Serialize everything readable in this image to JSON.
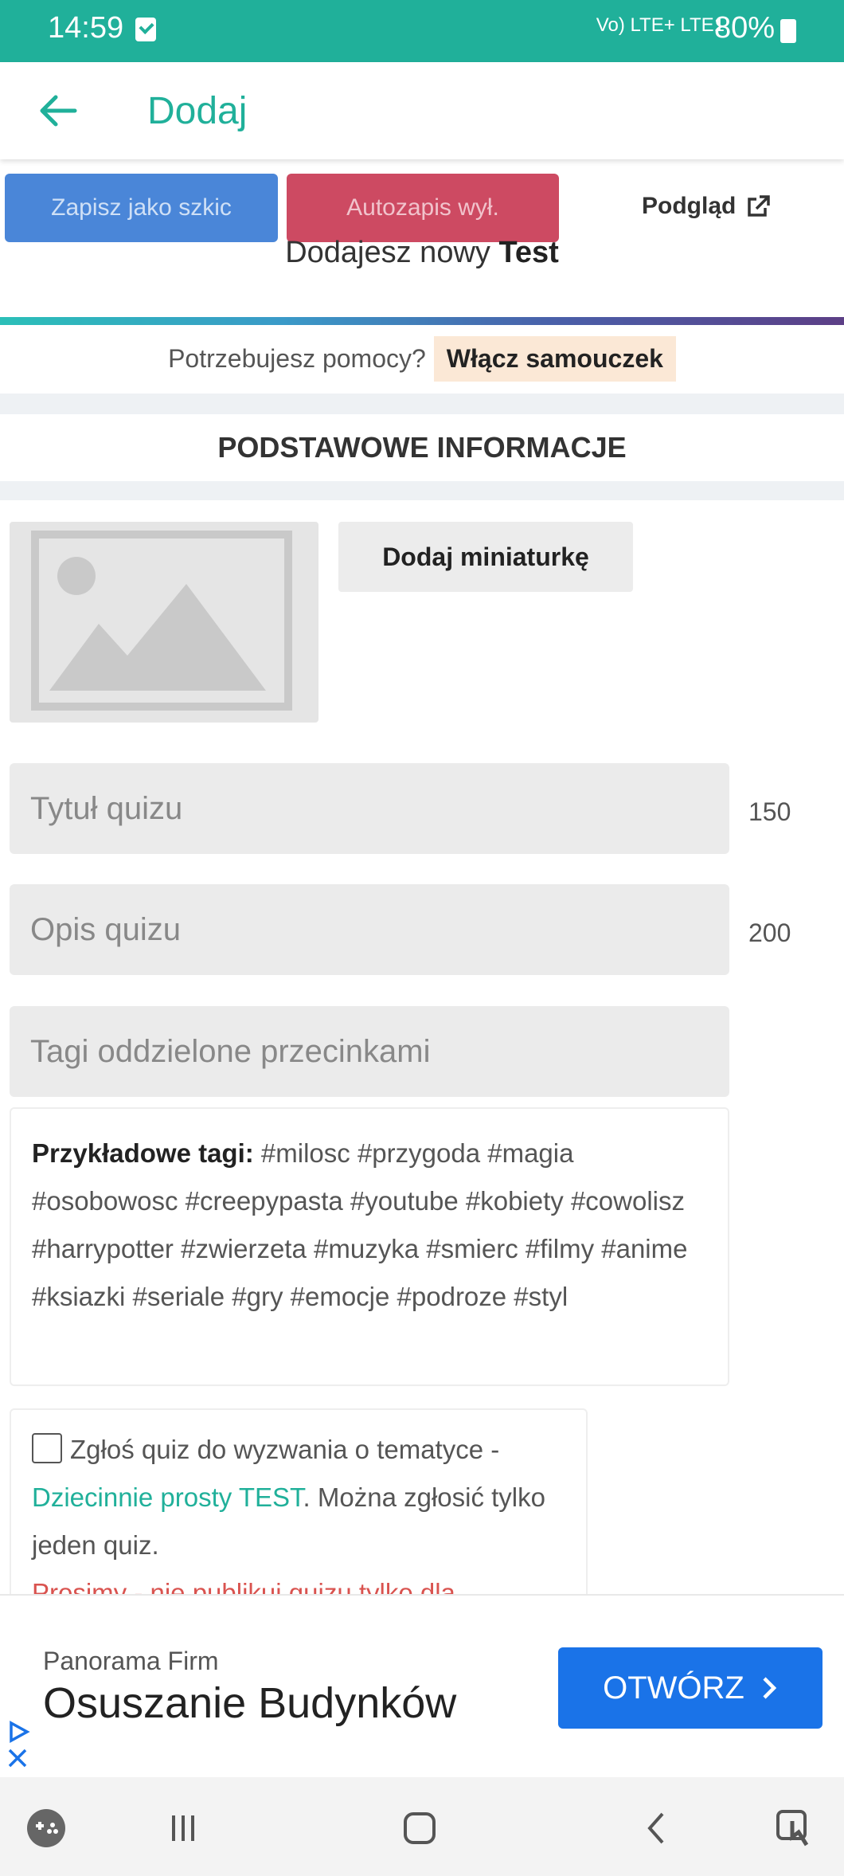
{
  "status_bar": {
    "time": "14:59",
    "network": "Vo) LTE+ LTE1",
    "battery": "80%"
  },
  "header": {
    "title": "Dodaj",
    "back_icon": "arrow-left-icon"
  },
  "toolbar": {
    "draft_label": "Zapisz jako szkic",
    "autosave_label": "Autozapis wył.",
    "preview_label": "Podgląd",
    "preview_icon": "external-link-icon"
  },
  "adding": {
    "prefix": "Dodajesz nowy",
    "type": "Test"
  },
  "help": {
    "question": "Potrzebujesz pomocy?",
    "tutorial_label": "Włącz samouczek"
  },
  "section": {
    "title": "PODSTAWOWE INFORMACJE"
  },
  "thumbnail": {
    "button_label": "Dodaj miniaturkę",
    "icon": "image-placeholder-icon"
  },
  "fields": {
    "title": {
      "placeholder": "Tytuł quizu",
      "counter": "150"
    },
    "description": {
      "placeholder": "Opis quizu",
      "counter": "200"
    },
    "tags": {
      "placeholder": "Tagi oddzielone przecinkami"
    }
  },
  "tags_examples": {
    "label": "Przykładowe tagi:",
    "text": "#milosc #przygoda #magia #osobowosc #creepypasta #youtube #kobiety #cowolisz #harrypotter #zwierzeta #muzyka #smierc #filmy #anime #ksiazki #seriale #gry #emocje #podroze #styl"
  },
  "challenge": {
    "text_before": "Zgłoś quiz do wyzwania o tematyce -",
    "link": "Dziecinnie prosty TEST",
    "text_after": ". Można zgłosić tylko jeden quiz.",
    "warning": "Prosimy - nie publikuj quizu tylko dla"
  },
  "ad": {
    "company": "Panorama Firm",
    "headline": "Osuszanie Budynków",
    "button_label": "OTWÓRZ"
  },
  "colors": {
    "accent": "#20b09a",
    "draft": "#4a86d8",
    "autosave": "#cd4a62",
    "ad_button": "#1a73e8"
  }
}
